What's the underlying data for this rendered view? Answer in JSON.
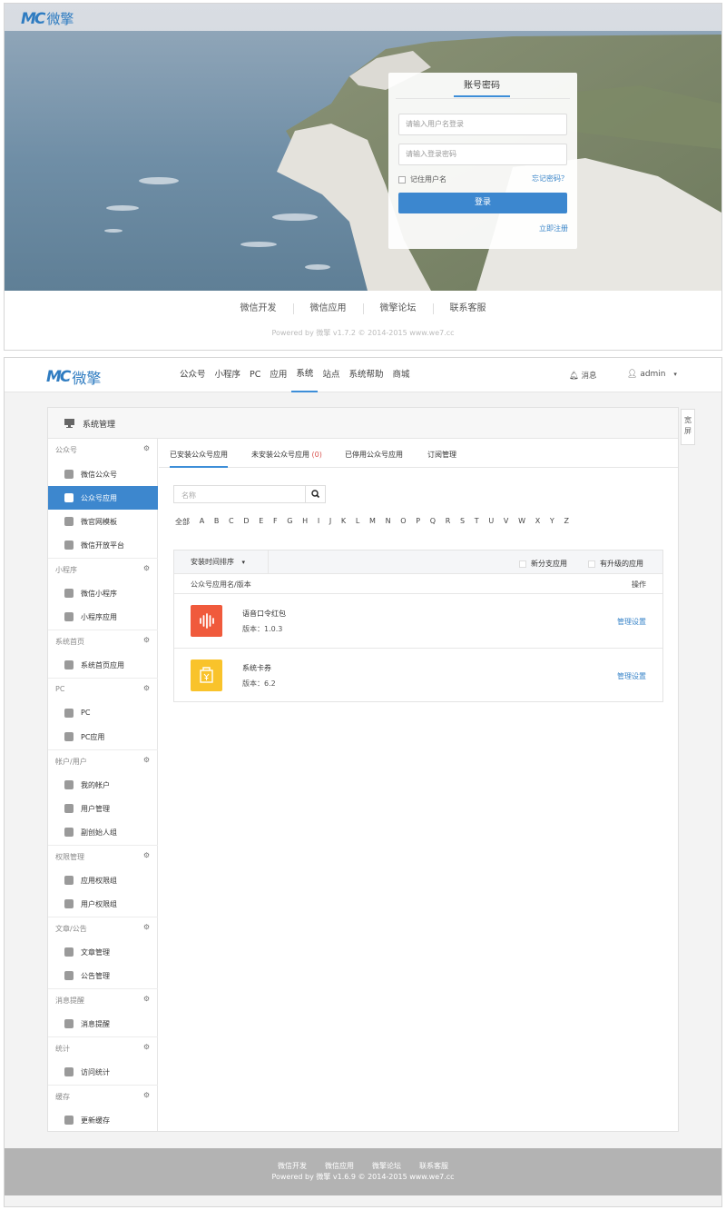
{
  "login": {
    "logo_mark": "MC",
    "logo_text": "微擎",
    "tab": "账号密码",
    "username_placeholder": "请输入用户名登录",
    "password_placeholder": "请输入登录密码",
    "remember": "记住用户名",
    "forgot": "忘记密码？",
    "submit": "登录",
    "register": "立即注册",
    "footer_links": [
      "微信开发",
      "微信应用",
      "微擎论坛",
      "联系客服"
    ],
    "copyright": "Powered by 微擎 v1.7.2 © 2014-2015 www.we7.cc"
  },
  "admin": {
    "logo_mark": "MC",
    "logo_text": "微擎",
    "nav": [
      "公众号",
      "小程序",
      "PC",
      "应用",
      "系统",
      "站点",
      "系统帮助",
      "商城"
    ],
    "active_nav": 4,
    "messages": "消息",
    "user": "admin",
    "card_title": "系统管理",
    "wide_toggle": "宽屏",
    "sidebar": [
      {
        "group": "公众号",
        "items": [
          "微信公众号",
          "公众号应用",
          "微官网模板",
          "微信开放平台"
        ]
      },
      {
        "group": "小程序",
        "items": [
          "微信小程序",
          "小程序应用"
        ]
      },
      {
        "group": "系统首页",
        "items": [
          "系统首页应用"
        ]
      },
      {
        "group": "PC",
        "items": [
          "PC",
          "PC应用"
        ]
      },
      {
        "group": "帐户/用户",
        "items": [
          "我的帐户",
          "用户管理",
          "副创始人组"
        ]
      },
      {
        "group": "权限管理",
        "items": [
          "应用权限组",
          "用户权限组"
        ]
      },
      {
        "group": "文章/公告",
        "items": [
          "文章管理",
          "公告管理"
        ]
      },
      {
        "group": "消息提醒",
        "items": [
          "消息提醒"
        ]
      },
      {
        "group": "统计",
        "items": [
          "访问统计"
        ]
      },
      {
        "group": "缓存",
        "items": [
          "更新缓存"
        ]
      }
    ],
    "active_item": "公众号应用",
    "tabs": {
      "installed": "已安装公众号应用",
      "uninstalled": "未安装公众号应用",
      "uninstalled_count": "(0)",
      "disabled": "已停用公众号应用",
      "subscribe": "订阅管理"
    },
    "search_placeholder": "名称",
    "letters": [
      "全部",
      "A",
      "B",
      "C",
      "D",
      "E",
      "F",
      "G",
      "H",
      "I",
      "J",
      "K",
      "L",
      "M",
      "N",
      "O",
      "P",
      "Q",
      "R",
      "S",
      "T",
      "U",
      "V",
      "W",
      "X",
      "Y",
      "Z"
    ],
    "sort_label": "安装时间排序",
    "filter_new": "新分支应用",
    "filter_upgrade": "有升级的应用",
    "col_name": "公众号应用名/版本",
    "col_action": "操作",
    "apps": [
      {
        "name": "语音口令红包",
        "version": "版本：1.0.3",
        "manage": "管理设置",
        "color": "#f05a3c"
      },
      {
        "name": "系统卡券",
        "version": "版本：6.2",
        "manage": "管理设置",
        "color": "#f9c32b"
      }
    ],
    "footer_links": [
      "微信开发",
      "微信应用",
      "微擎论坛",
      "联系客服"
    ],
    "copyright": "Powered by 微擎 v1.6.9 © 2014-2015 www.we7.cc"
  }
}
